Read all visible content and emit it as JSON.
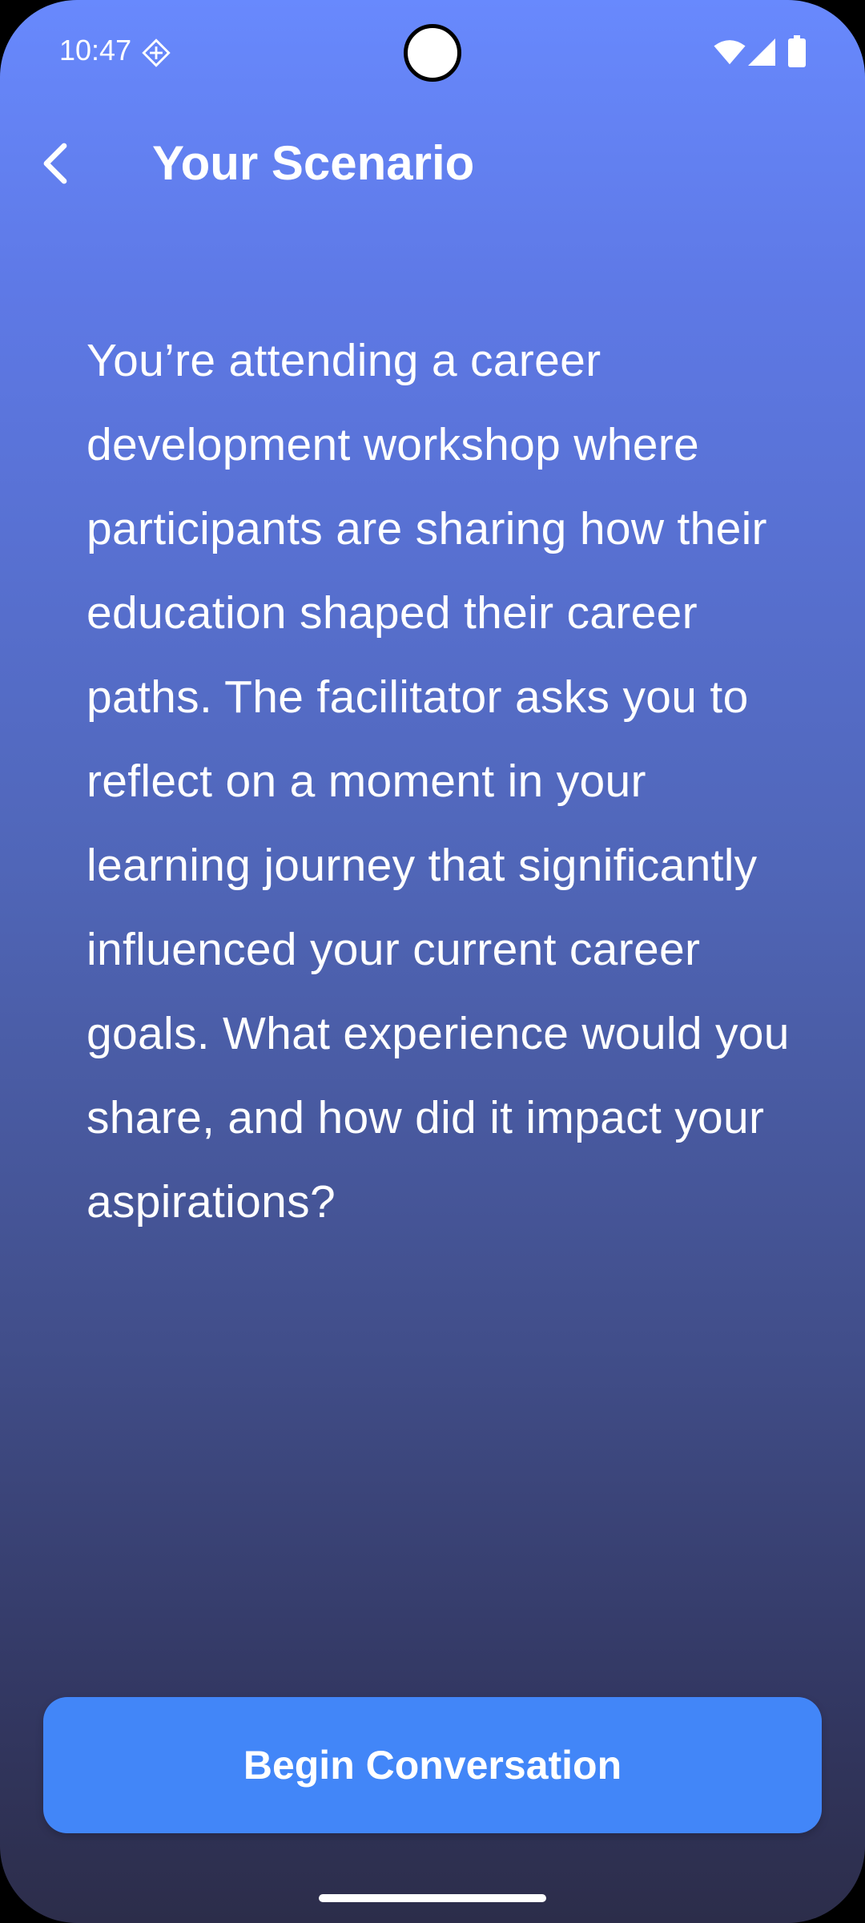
{
  "status_bar": {
    "time": "10:47",
    "icons": [
      "notification-icon",
      "wifi-icon",
      "signal-icon",
      "battery-icon"
    ]
  },
  "header": {
    "back_icon": "chevron-left-icon",
    "title": "Your Scenario"
  },
  "scenario": {
    "text": "You’re attending a career development workshop where participants are sharing how their education shaped their career paths. The facilitator asks you to reflect on a moment in your learning journey that significantly influenced your current career goals. What experience would you share, and how did it impact your aspirations?"
  },
  "actions": {
    "begin_label": "Begin Conversation"
  },
  "colors": {
    "gradient_top": "#6889fd",
    "gradient_bottom": "#2c2d4a",
    "button": "#4286f8",
    "text": "#ffffff"
  }
}
